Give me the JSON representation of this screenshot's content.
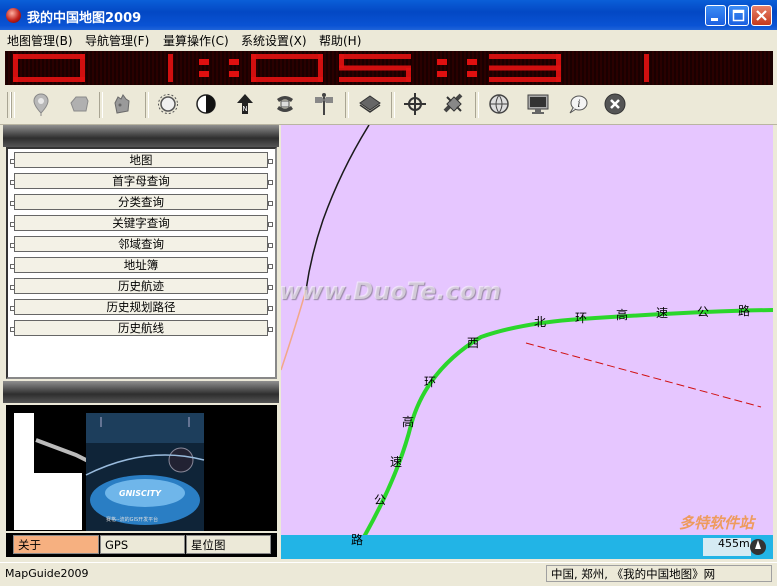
{
  "window": {
    "title": "我的中国地图2009"
  },
  "menu": [
    "地图管理(B)",
    "导航管理(F)",
    "量算操作(C)",
    "系统设置(X)",
    "帮助(H)"
  ],
  "led": {
    "text": "01:05:31",
    "color": "#e01010"
  },
  "toolbar": {
    "icons": [
      "pin-icon",
      "hand-icon",
      "hand-pan-icon",
      "sun-icon",
      "moon-icon",
      "north-arrow-icon",
      "rotate-map-icon",
      "signpost-icon",
      "layers-icon",
      "crosshair-icon",
      "satellite-icon",
      "globe-icon",
      "monitor-icon",
      "info-icon",
      "close-circle-icon"
    ]
  },
  "sidebar": {
    "items": [
      {
        "label": "地图"
      },
      {
        "label": "首字母查询"
      },
      {
        "label": "分类查询"
      },
      {
        "label": "关键字查询"
      },
      {
        "label": "邻域查询"
      },
      {
        "label": "地址簿"
      },
      {
        "label": "历史航迹"
      },
      {
        "label": "历史规划路径"
      },
      {
        "label": "历史航线"
      }
    ]
  },
  "preview": {
    "logo_text": "GNISCITY",
    "caption": "赛格--流的GIS开发平台"
  },
  "tabs": [
    {
      "label": "关于",
      "active": true
    },
    {
      "label": "GPS",
      "active": false
    },
    {
      "label": "星位图",
      "active": false
    }
  ],
  "map": {
    "watermark": "www.DuoTe.com",
    "road_north": [
      "北",
      "环",
      "高",
      "速",
      "公",
      "路"
    ],
    "road_west": [
      "西",
      "环",
      "高",
      "速",
      "公",
      "路"
    ],
    "scale_text": "455m",
    "colors": {
      "land": "#e6c6ff",
      "road": "#2bd62b",
      "water": "#22b4e6"
    },
    "site_logo": "多特软件站"
  },
  "status": {
    "left": "MapGuide2009",
    "right": "中国, 郑州, 《我的中国地图》网"
  }
}
